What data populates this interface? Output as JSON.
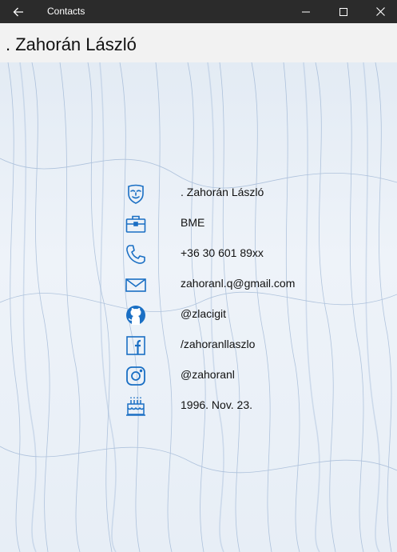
{
  "window": {
    "title": "Contacts"
  },
  "header": {
    "title": ". Zahorán László"
  },
  "contact": {
    "items": [
      {
        "icon": "anonymous-mask-icon",
        "value": ". Zahorán László"
      },
      {
        "icon": "briefcase-icon",
        "value": "BME"
      },
      {
        "icon": "phone-icon",
        "value": "+36 30 601 89xx"
      },
      {
        "icon": "mail-icon",
        "value": "zahoranl.q@gmail.com"
      },
      {
        "icon": "github-icon",
        "value": "@zlacigit"
      },
      {
        "icon": "facebook-icon",
        "value": "/zahoranllaszlo"
      },
      {
        "icon": "instagram-icon",
        "value": "@zahoranl"
      },
      {
        "icon": "birthday-cake-icon",
        "value": "1996. Nov. 23."
      }
    ]
  },
  "colors": {
    "accent": "#1a6fc4",
    "titlebar": "#2b2b2b",
    "header": "#f2f2f2"
  }
}
